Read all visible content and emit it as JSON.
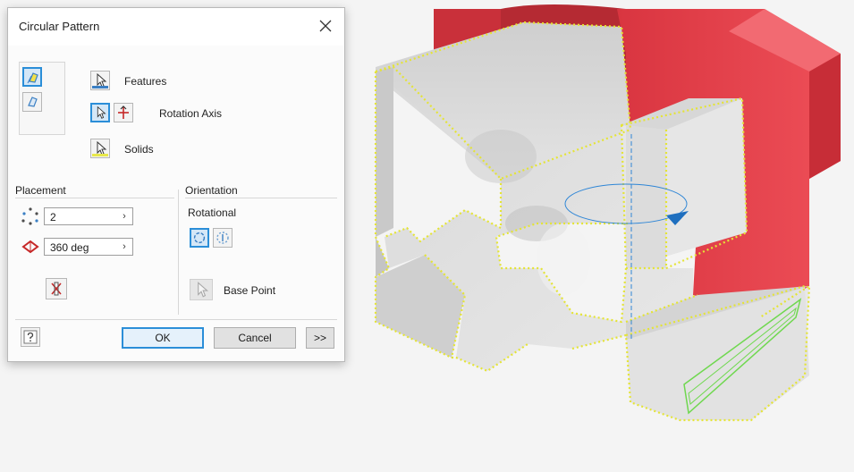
{
  "dialog": {
    "title": "Circular Pattern",
    "features_label": "Features",
    "rotation_axis_label": "Rotation Axis",
    "solids_label": "Solids",
    "placement": {
      "label": "Placement",
      "count_value": "2",
      "angle_value": "360 deg"
    },
    "orientation": {
      "label": "Orientation",
      "rotational_label": "Rotational",
      "base_point_label": "Base Point"
    },
    "buttons": {
      "ok": "OK",
      "cancel": "Cancel",
      "more": ">>"
    }
  },
  "colors": {
    "accent_blue": "#2b8ed8",
    "part_red": "#e8404a",
    "part_grey": "#d8d8d8",
    "selection_yellow": "#e4e436",
    "sketch_green": "#6fd84f",
    "axis_blue": "#2f86d6"
  },
  "icons": {
    "features": "cursor-arrow-icon",
    "rotation_axis": "cursor-arrow-icon",
    "flip": "flip-direction-icon",
    "solids": "cursor-arrow-icon",
    "help": "help-icon",
    "close": "close-icon"
  }
}
